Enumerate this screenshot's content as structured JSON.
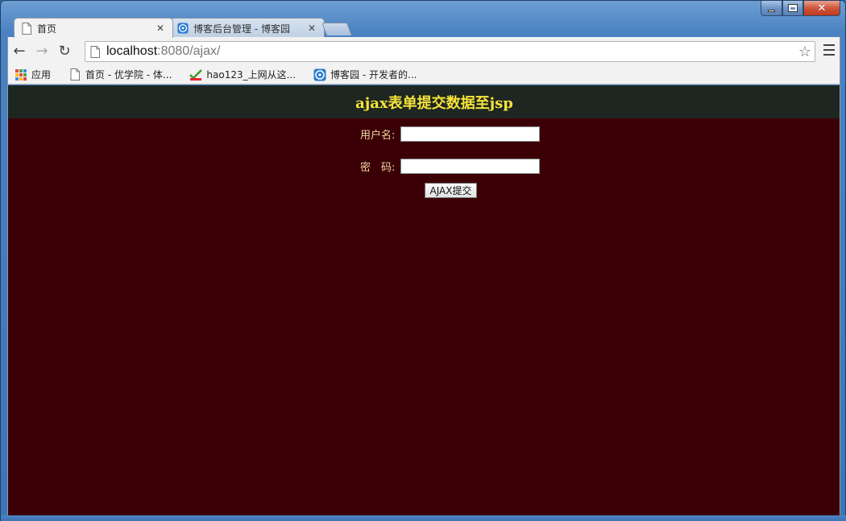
{
  "window": {
    "minimize_label": "",
    "maximize_label": "",
    "close_label": "✕"
  },
  "tabs": [
    {
      "title": "首页",
      "close": "✕",
      "active": true
    },
    {
      "title": "博客后台管理 - 博客园",
      "close": "✕",
      "active": false
    }
  ],
  "toolbar": {
    "url_host": "localhost",
    "url_rest": ":8080/ajax/",
    "back_icon": "←",
    "forward_icon": "→",
    "reload_icon": "↻",
    "star_icon": "☆"
  },
  "bookmarks": [
    {
      "label": "应用",
      "icon": "apps-grid-icon"
    },
    {
      "label": "首页 - 优学院 - 体...",
      "icon": "page-icon"
    },
    {
      "label": "hao123_上网从这...",
      "icon": "hao123-icon"
    },
    {
      "label": "博客园 - 开发者的...",
      "icon": "cnblogs-icon"
    }
  ],
  "page": {
    "title": "ajax表单提交数据至jsp",
    "username_label": "用户名:",
    "password_label": "密　码:",
    "username_value": "",
    "password_value": "",
    "submit_label": "AJAX提交"
  },
  "colors": {
    "page_bg": "#3b0006",
    "header_bg": "#1e2621",
    "title_color": "#f5e33a",
    "label_color": "#f0d8a8"
  }
}
